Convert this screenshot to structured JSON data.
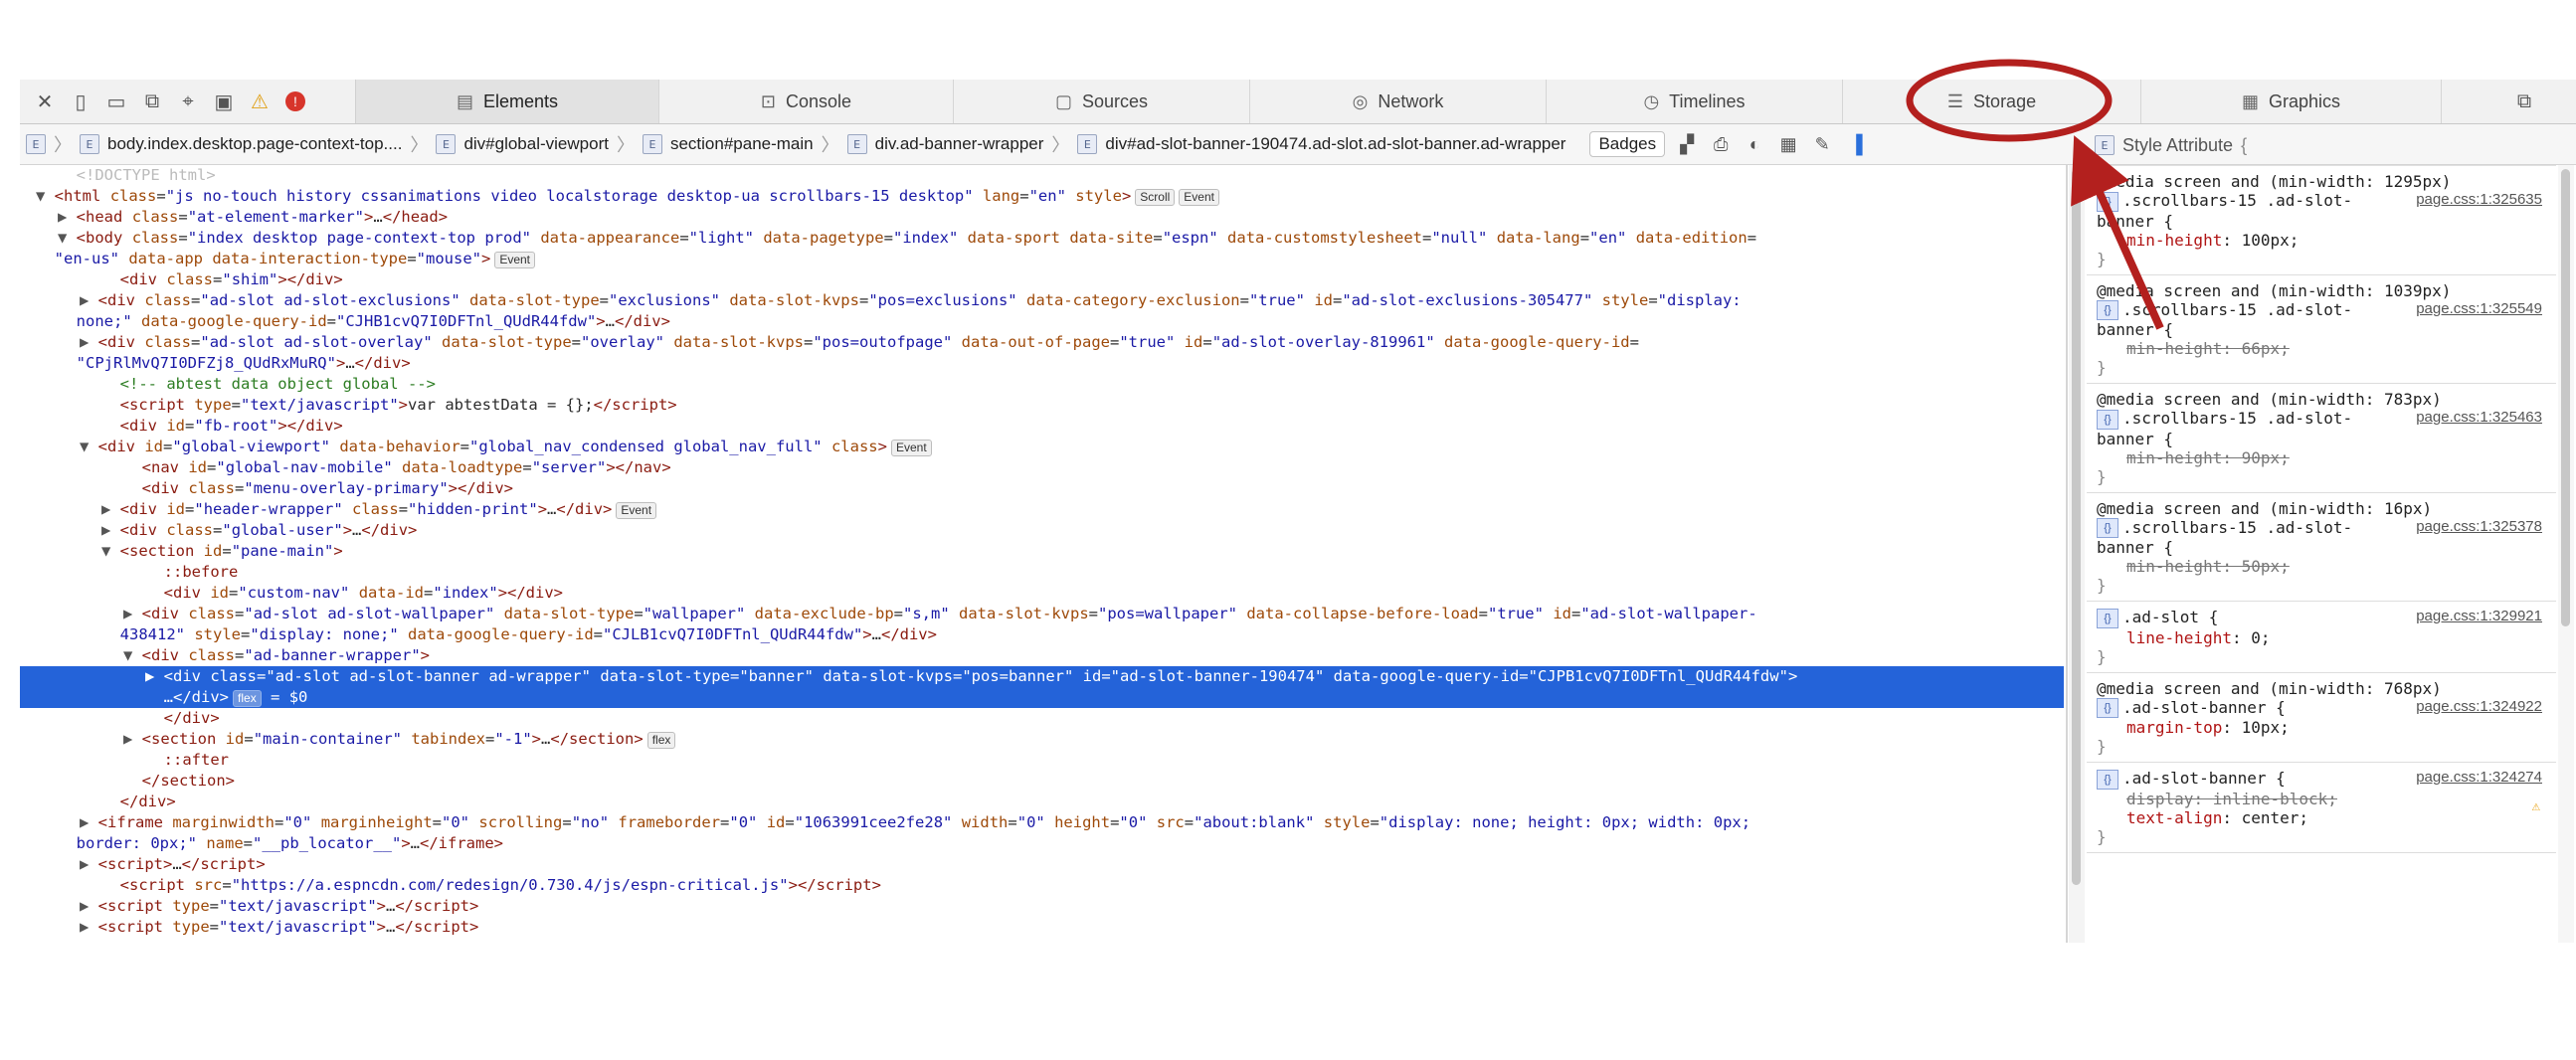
{
  "tabs": [
    {
      "label": "Elements",
      "icon": "elements-icon"
    },
    {
      "label": "Console",
      "icon": "console-icon"
    },
    {
      "label": "Sources",
      "icon": "sources-icon"
    },
    {
      "label": "Network",
      "icon": "network-icon"
    },
    {
      "label": "Timelines",
      "icon": "timelines-icon"
    },
    {
      "label": "Storage",
      "icon": "storage-icon"
    },
    {
      "label": "Graphics",
      "icon": "graphics-icon"
    }
  ],
  "breadcrumbs": [
    "body.index.desktop.page-context-top....",
    "div#global-viewport",
    "section#pane-main",
    "div.ad-banner-wrapper",
    "div#ad-slot-banner-190474.ad-slot.ad-slot-banner.ad-wrapper"
  ],
  "crumb_badge_letter": "E",
  "badges_label": "Badges",
  "sidebar": {
    "title": "Style Attribute",
    "title_brace": "{",
    "rules": [
      {
        "media": "@media screen and (min-width: 1295px)",
        "selector": ".scrollbars-15 .ad-slot-",
        "selector2": "banner {",
        "loc": "page.css:1:325635",
        "props": [
          {
            "name": "min-height",
            "value": "100px;",
            "struck": false
          }
        ]
      },
      {
        "media": "@media screen and (min-width: 1039px)",
        "selector": ".scrollbars-15 .ad-slot-",
        "selector2": "banner {",
        "loc": "page.css:1:325549",
        "props": [
          {
            "name": "min-height",
            "value": "66px;",
            "struck": true
          }
        ]
      },
      {
        "media": "@media screen and (min-width: 783px)",
        "selector": ".scrollbars-15 .ad-slot-",
        "selector2": "banner {",
        "loc": "page.css:1:325463",
        "props": [
          {
            "name": "min-height",
            "value": "90px;",
            "struck": true
          }
        ]
      },
      {
        "media": "@media screen and (min-width: 16px)",
        "selector": ".scrollbars-15 .ad-slot-",
        "selector2": "banner {",
        "loc": "page.css:1:325378",
        "props": [
          {
            "name": "min-height",
            "value": "50px;",
            "struck": true
          }
        ]
      },
      {
        "media": "",
        "selector": ".ad-slot {",
        "selector2": "",
        "loc": "page.css:1:329921",
        "props": [
          {
            "name": "line-height",
            "value": "0;",
            "struck": false
          }
        ]
      },
      {
        "media": "@media screen and (min-width: 768px)",
        "selector": ".ad-slot-banner {",
        "selector2": "",
        "loc": "page.css:1:324922",
        "props": [
          {
            "name": "margin-top",
            "value": "10px;",
            "struck": false
          }
        ]
      },
      {
        "media": "",
        "selector": ".ad-slot-banner {",
        "selector2": "",
        "loc": "page.css:1:324274",
        "props": [
          {
            "name": "display",
            "value": "inline-block;",
            "struck": true
          },
          {
            "name": "text-align",
            "value": "center;",
            "struck": false
          }
        ]
      }
    ]
  },
  "dom_lines": [
    {
      "i": 1,
      "t": "",
      "h": "<span class='cm' style='color:#bbb'>&lt;!DOCTYPE html&gt;</span>"
    },
    {
      "i": 0,
      "t": "▼",
      "h": "<span class='tag'>&lt;html</span> <span class='an'>class</span>=<span class='av'>\"js no-touch history cssanimations video localstorage desktop-ua scrollbars-15 desktop\"</span> <span class='an'>lang</span>=<span class='av'>\"en\"</span> <span class='an'>style</span><span class='tag'>&gt;</span><span class='pill'>Scroll</span><span class='pill'>Event</span>"
    },
    {
      "i": 1,
      "t": "▶",
      "h": "<span class='tag'>&lt;head</span> <span class='an'>class</span>=<span class='av'>\"at-element-marker\"</span><span class='tag'>&gt;</span>…<span class='tag'>&lt;/head&gt;</span>"
    },
    {
      "i": 1,
      "t": "▼",
      "h": "<span class='tag'>&lt;body</span> <span class='an'>class</span>=<span class='av'>\"index desktop page-context-top prod\"</span> <span class='an'>data-appearance</span>=<span class='av'>\"light\"</span> <span class='an'>data-pagetype</span>=<span class='av'>\"index\"</span> <span class='an'>data-sport</span> <span class='an'>data-site</span>=<span class='av'>\"espn\"</span> <span class='an'>data-customstylesheet</span>=<span class='av'>\"null\"</span> <span class='an'>data-lang</span>=<span class='av'>\"en\"</span> <span class='an'>data-edition</span>="
    },
    {
      "i": 0,
      "t": "",
      "h": "<span class='av'>\"en-us\"</span> <span class='an'>data-app</span> <span class='an'>data-interaction-type</span>=<span class='av'>\"mouse\"</span><span class='tag'>&gt;</span><span class='pill'>Event</span>"
    },
    {
      "i": 3,
      "t": "",
      "h": "<span class='tag'>&lt;div</span> <span class='an'>class</span>=<span class='av'>\"shim\"</span><span class='tag'>&gt;&lt;/div&gt;</span>"
    },
    {
      "i": 2,
      "t": "▶",
      "h": "<span class='tag'>&lt;div</span> <span class='an'>class</span>=<span class='av'>\"ad-slot ad-slot-exclusions\"</span> <span class='an'>data-slot-type</span>=<span class='av'>\"exclusions\"</span> <span class='an'>data-slot-kvps</span>=<span class='av'>\"pos=exclusions\"</span> <span class='an'>data-category-exclusion</span>=<span class='av'>\"true\"</span> <span class='an'>id</span>=<span class='av'>\"ad-slot-exclusions-305477\"</span> <span class='an'>style</span>=<span class='av'>\"display:</span>"
    },
    {
      "i": 1,
      "t": "",
      "h": "<span class='av'>none;\"</span> <span class='an'>data-google-query-id</span>=<span class='av'>\"CJHB1cvQ7I0DFTnl_QUdR44fdw\"</span><span class='tag'>&gt;</span>…<span class='tag'>&lt;/div&gt;</span>"
    },
    {
      "i": 2,
      "t": "▶",
      "h": "<span class='tag'>&lt;div</span> <span class='an'>class</span>=<span class='av'>\"ad-slot ad-slot-overlay\"</span> <span class='an'>data-slot-type</span>=<span class='av'>\"overlay\"</span> <span class='an'>data-slot-kvps</span>=<span class='av'>\"pos=outofpage\"</span> <span class='an'>data-out-of-page</span>=<span class='av'>\"true\"</span> <span class='an'>id</span>=<span class='av'>\"ad-slot-overlay-819961\"</span> <span class='an'>data-google-query-id</span>="
    },
    {
      "i": 1,
      "t": "",
      "h": "<span class='av'>\"CPjRlMvQ7I0DFZj8_QUdRxMuRQ\"</span><span class='tag'>&gt;</span>…<span class='tag'>&lt;/div&gt;</span>"
    },
    {
      "i": 3,
      "t": "",
      "h": "<span class='cm'>&lt;!-- abtest data object global --&gt;</span>"
    },
    {
      "i": 3,
      "t": "",
      "h": "<span class='tag'>&lt;script</span> <span class='an'>type</span>=<span class='av'>\"text/javascript\"</span><span class='tag'>&gt;</span>var abtestData = {};<span class='tag'>&lt;/script&gt;</span>"
    },
    {
      "i": 3,
      "t": "",
      "h": "<span class='tag'>&lt;div</span> <span class='an'>id</span>=<span class='av'>\"fb-root\"</span><span class='tag'>&gt;&lt;/div&gt;</span>"
    },
    {
      "i": 2,
      "t": "▼",
      "h": "<span class='tag'>&lt;div</span> <span class='an'>id</span>=<span class='av'>\"global-viewport\"</span> <span class='an'>data-behavior</span>=<span class='av'>\"global_nav_condensed global_nav_full\"</span> <span class='an'>class</span><span class='tag'>&gt;</span><span class='pill'>Event</span>"
    },
    {
      "i": 4,
      "t": "",
      "h": "<span class='tag'>&lt;nav</span> <span class='an'>id</span>=<span class='av'>\"global-nav-mobile\"</span> <span class='an'>data-loadtype</span>=<span class='av'>\"server\"</span><span class='tag'>&gt;&lt;/nav&gt;</span>"
    },
    {
      "i": 4,
      "t": "",
      "h": "<span class='tag'>&lt;div</span> <span class='an'>class</span>=<span class='av'>\"menu-overlay-primary\"</span><span class='tag'>&gt;&lt;/div&gt;</span>"
    },
    {
      "i": 3,
      "t": "▶",
      "h": "<span class='tag'>&lt;div</span> <span class='an'>id</span>=<span class='av'>\"header-wrapper\"</span> <span class='an'>class</span>=<span class='av'>\"hidden-print\"</span><span class='tag'>&gt;</span>…<span class='tag'>&lt;/div&gt;</span><span class='pill'>Event</span>"
    },
    {
      "i": 3,
      "t": "▶",
      "h": "<span class='tag'>&lt;div</span> <span class='an'>class</span>=<span class='av'>\"global-user\"</span><span class='tag'>&gt;</span>…<span class='tag'>&lt;/div&gt;</span>"
    },
    {
      "i": 3,
      "t": "▼",
      "h": "<span class='tag'>&lt;section</span> <span class='an'>id</span>=<span class='av'>\"pane-main\"</span><span class='tag'>&gt;</span>"
    },
    {
      "i": 5,
      "t": "",
      "h": "<span class='tag'>::before</span>"
    },
    {
      "i": 5,
      "t": "",
      "h": "<span class='tag'>&lt;div</span> <span class='an'>id</span>=<span class='av'>\"custom-nav\"</span> <span class='an'>data-id</span>=<span class='av'>\"index\"</span><span class='tag'>&gt;&lt;/div&gt;</span>"
    },
    {
      "i": 4,
      "t": "▶",
      "h": "<span class='tag'>&lt;div</span> <span class='an'>class</span>=<span class='av'>\"ad-slot ad-slot-wallpaper\"</span> <span class='an'>data-slot-type</span>=<span class='av'>\"wallpaper\"</span> <span class='an'>data-exclude-bp</span>=<span class='av'>\"s,m\"</span> <span class='an'>data-slot-kvps</span>=<span class='av'>\"pos=wallpaper\"</span> <span class='an'>data-collapse-before-load</span>=<span class='av'>\"true\"</span> <span class='an'>id</span>=<span class='av'>\"ad-slot-wallpaper-</span>"
    },
    {
      "i": 3,
      "t": "",
      "h": "<span class='av'>438412\"</span> <span class='an'>style</span>=<span class='av'>\"display: none;\"</span> <span class='an'>data-google-query-id</span>=<span class='av'>\"CJLB1cvQ7I0DFTnl_QUdR44fdw\"</span><span class='tag'>&gt;</span>…<span class='tag'>&lt;/div&gt;</span>"
    },
    {
      "i": 4,
      "t": "▼",
      "h": "<span class='tag'>&lt;div</span> <span class='an'>class</span>=<span class='av'>\"ad-banner-wrapper\"</span><span class='tag'>&gt;</span>"
    },
    {
      "i": 5,
      "t": "▶",
      "sel": true,
      "h": "<span class='tag'>&lt;div</span> <span class='an'>class</span>=<span class='av'>\"ad-slot ad-slot-banner ad-wrapper\"</span> <span class='an'>data-slot-type</span>=<span class='av'>\"banner\"</span> <span class='an'>data-slot-kvps</span>=<span class='av'>\"pos=banner\"</span> <span class='an'>id</span>=<span class='av'>\"ad-slot-banner-190474\"</span> <span class='an'>data-google-query-id</span>=<span class='av'>\"CJPB1cvQ7I0DFTnl_QUdR44fdw\"</span><span class='tag'>&gt;</span>"
    },
    {
      "i": 5,
      "t": "",
      "sel": true,
      "h": "…<span class='tag'>&lt;/div&gt;</span><span class='pill'>flex</span> = $0"
    },
    {
      "i": 5,
      "t": "",
      "h": "<span class='tag'>&lt;/div&gt;</span>"
    },
    {
      "i": 4,
      "t": "▶",
      "h": "<span class='tag'>&lt;section</span> <span class='an'>id</span>=<span class='av'>\"main-container\"</span> <span class='an'>tabindex</span>=<span class='av'>\"-1\"</span><span class='tag'>&gt;</span>…<span class='tag'>&lt;/section&gt;</span><span class='pill'>flex</span>"
    },
    {
      "i": 5,
      "t": "",
      "h": "<span class='tag'>::after</span>"
    },
    {
      "i": 4,
      "t": "",
      "h": "<span class='tag'>&lt;/section&gt;</span>"
    },
    {
      "i": 3,
      "t": "",
      "h": "<span class='tag'>&lt;/div&gt;</span>"
    },
    {
      "i": 2,
      "t": "▶",
      "h": "<span class='tag'>&lt;iframe</span> <span class='an'>marginwidth</span>=<span class='av'>\"0\"</span> <span class='an'>marginheight</span>=<span class='av'>\"0\"</span> <span class='an'>scrolling</span>=<span class='av'>\"no\"</span> <span class='an'>frameborder</span>=<span class='av'>\"0\"</span> <span class='an'>id</span>=<span class='av'>\"1063991cee2fe28\"</span> <span class='an'>width</span>=<span class='av'>\"0\"</span> <span class='an'>height</span>=<span class='av'>\"0\"</span> <span class='an'>src</span>=<span class='av'>\"about:blank\"</span> <span class='an'>style</span>=<span class='av'>\"display: none; height: 0px; width: 0px;</span>"
    },
    {
      "i": 1,
      "t": "",
      "h": "<span class='av'>border: 0px;\"</span> <span class='an'>name</span>=<span class='av'>\"__pb_locator__\"</span><span class='tag'>&gt;</span>…<span class='tag'>&lt;/iframe&gt;</span>"
    },
    {
      "i": 2,
      "t": "▶",
      "h": "<span class='tag'>&lt;script&gt;</span>…<span class='tag'>&lt;/script&gt;</span>"
    },
    {
      "i": 3,
      "t": "",
      "h": "<span class='tag'>&lt;script</span> <span class='an'>src</span>=<span class='av'>\"https://a.espncdn.com/redesign/0.730.4/js/espn-critical.js\"</span><span class='tag'>&gt;&lt;/script&gt;</span>"
    },
    {
      "i": 2,
      "t": "▶",
      "h": "<span class='tag'>&lt;script</span> <span class='an'>type</span>=<span class='av'>\"text/javascript\"</span><span class='tag'>&gt;</span>…<span class='tag'>&lt;/script&gt;</span>"
    },
    {
      "i": 2,
      "t": "▶",
      "h": "<span class='tag'>&lt;script</span> <span class='an'>type</span>=<span class='av'>\"text/javascript\"</span><span class='tag'>&gt;</span>…<span class='tag'>&lt;/script&gt;</span>"
    }
  ],
  "colors": {
    "annotation": "#b3201e",
    "selection": "#2463d9"
  }
}
